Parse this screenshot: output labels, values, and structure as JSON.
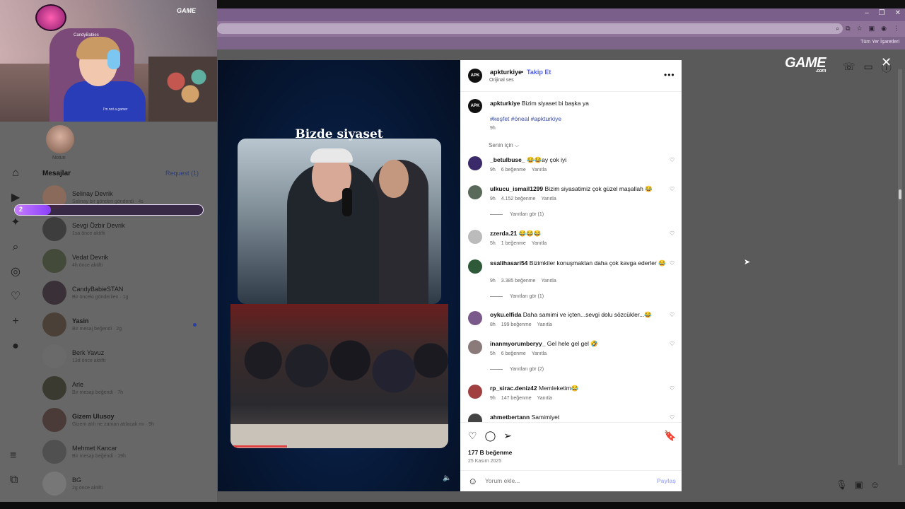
{
  "browser": {
    "bookmarks_label": "Tüm Yer İşaretleri",
    "window_controls": [
      "–",
      "❐",
      "✕"
    ],
    "addr_icons": [
      "⌕",
      "⧉",
      "☆",
      "▣",
      "◉",
      "⋮"
    ]
  },
  "webcam": {
    "streamer_name": "CandyBabies",
    "brand": "GAME",
    "shirt_text": "I'm not a gamer"
  },
  "sidebar": {
    "note_label": "Notun",
    "messages_title": "Mesajlar",
    "requests_label": "Request (1)",
    "nav_icons": [
      "home-icon",
      "reels-icon",
      "explore-icon",
      "search-icon",
      "compass-icon",
      "heart-icon",
      "create-icon",
      "profile-icon"
    ],
    "nav_glyphs": [
      "⌂",
      "▶",
      "✦",
      "⌕",
      "◎",
      "♡",
      "+",
      "●"
    ],
    "bottom_glyphs": [
      "≡",
      "⧉"
    ],
    "conversations": [
      {
        "name": "Selinay Devrik",
        "sub": "Selinay bir gönderi gönderdi · 4s",
        "bold": false
      },
      {
        "name": "Sevgi Özbir Devrik",
        "sub": "1sa önce aktifti",
        "bold": false
      },
      {
        "name": "Vedat Devrik",
        "sub": "4h önce aktifti",
        "bold": false
      },
      {
        "name": "CandyBabieSTAN",
        "sub": "Bir önceki gönderilen · 1g",
        "bold": false
      },
      {
        "name": "Yasin",
        "sub": "Bir mesaj beğendi · 2g",
        "bold": true
      },
      {
        "name": "Berk Yavuz",
        "sub": "13d önce aktifti",
        "bold": false
      },
      {
        "name": "Arle",
        "sub": "Bir mesajı beğendi · 7h",
        "bold": false
      },
      {
        "name": "Gizem Ulusoy",
        "sub": "Gizem atılı ne zaman atılacak mı · 9h",
        "bold": true
      },
      {
        "name": "Mehmet Kancar",
        "sub": "Bir mesajı beğendi · 19h",
        "bold": false
      },
      {
        "name": "BG",
        "sub": "2g önce aktifti",
        "bold": false
      }
    ],
    "progress": {
      "number": "2",
      "fraction": 0.19
    }
  },
  "brand": {
    "name": "GAME",
    "suffix": ".com",
    "top_icons": [
      "☏",
      "▭",
      "ⓘ"
    ],
    "close_glyph": "✕",
    "bottom_icons": [
      "🎙",
      "▣",
      "☺"
    ]
  },
  "video": {
    "caption": "Bizde siyaset",
    "mute_glyph": "🔈"
  },
  "post": {
    "username": "apkturkiye",
    "avatar_text": "APK",
    "separator": "•",
    "follow_label": "Takip Et",
    "audio": "Orijinal ses",
    "more_glyph": "•••",
    "caption_user": "apkturkiye",
    "caption_text": "Bizim siyaset bi başka ya",
    "hashtags": "#keşfet #öneal #apkturkiye",
    "caption_time": "9h",
    "filter_label": "Senin için ⌵",
    "comments": [
      {
        "user": "_betulbuse_",
        "text": "😂😂ay çok iyi",
        "time": "9h",
        "likes": "6 beğenme",
        "reply": "Yanıtla",
        "see_replies": "",
        "color": "#3b2a6a"
      },
      {
        "user": "ulkucu_ismail1299",
        "text": "Bizim siyasatimiz çok güzel maşallah 😂",
        "time": "9h",
        "likes": "4.152 beğenme",
        "reply": "Yanıtla",
        "see_replies": "Yanıtları gör (1)",
        "color": "#5a6a5a"
      },
      {
        "user": "zzerda.21",
        "text": "😂😂😂",
        "time": "5h",
        "likes": "1 beğenme",
        "reply": "Yanıtla",
        "see_replies": "",
        "color": "#bbbbbb"
      },
      {
        "user": "ssalihasari54",
        "text": "Bizimkiler konuşmaktan daha çok kavga ederler 😂",
        "time": "9h",
        "likes": "3.385 beğenme",
        "reply": "Yanıtla",
        "see_replies": "Yanıtları gör (1)",
        "color": "#2e5a3a"
      },
      {
        "user": "oyku.elfida",
        "text": "Daha samimi ve içten...sevgi dolu sözcükler...😂",
        "time": "8h",
        "likes": "199 beğenme",
        "reply": "Yanıtla",
        "see_replies": "",
        "color": "#7a5a8a"
      },
      {
        "user": "inanmyorumberyy_",
        "text": "Gel hele gel gel 🤣",
        "time": "5h",
        "likes": "6 beğenme",
        "reply": "Yanıtla",
        "see_replies": "Yanıtları gör (2)",
        "color": "#8a7a7a"
      },
      {
        "user": "rp_sirac.deniz42",
        "text": "Memleketim😂",
        "time": "9h",
        "likes": "147 beğenme",
        "reply": "Yanıtla",
        "see_replies": "",
        "color": "#a04040"
      },
      {
        "user": "ahmetbertann",
        "text": "Samimiyet",
        "time": "",
        "likes": "",
        "reply": "",
        "see_replies": "",
        "color": "#444444"
      }
    ],
    "heart_glyph": "♡",
    "action_glyphs": [
      "♡",
      "◯",
      "➢"
    ],
    "save_glyph": "🔖",
    "likes_count": "177 B beğenme",
    "date": "25 Kasım 2025",
    "emoji_glyph": "☺",
    "comment_placeholder": "Yorum ekle...",
    "share_label": "Paylaş"
  }
}
